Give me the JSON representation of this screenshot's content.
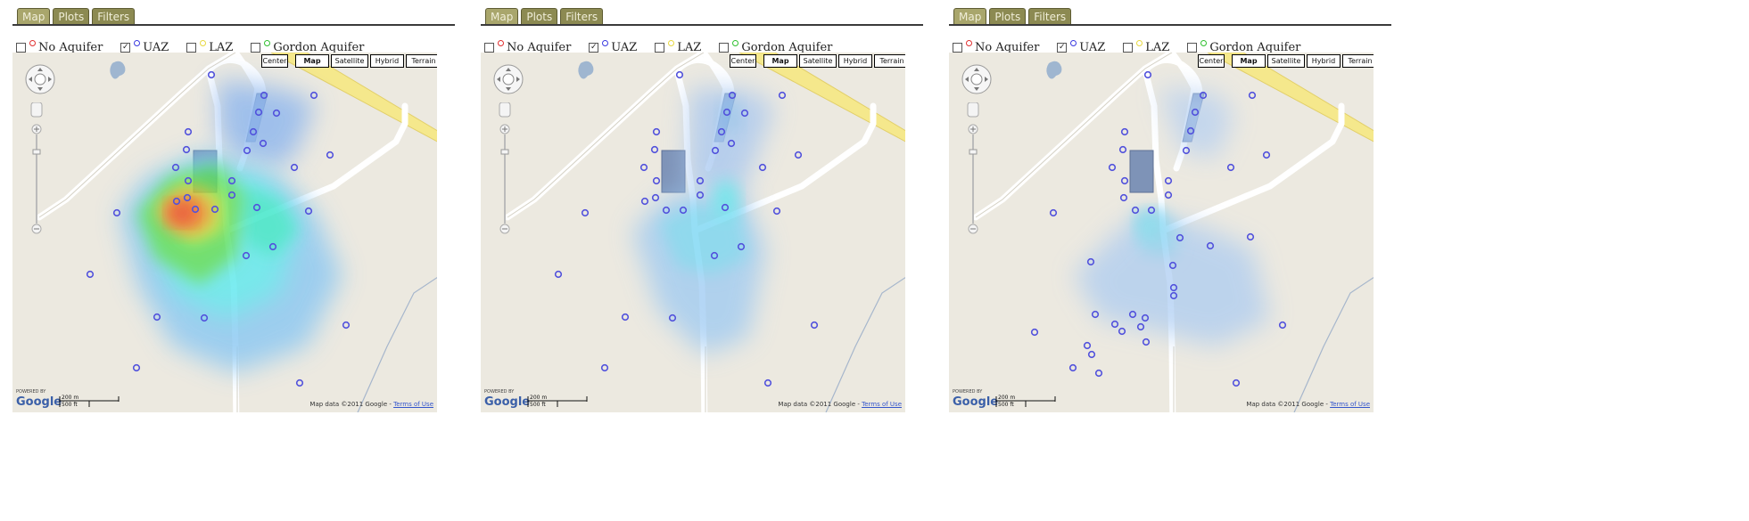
{
  "tabs": [
    "Map",
    "Plots",
    "Filters"
  ],
  "aquifers": [
    {
      "label": "No Aquifer",
      "checked": false,
      "color": "#e03030"
    },
    {
      "label": "UAZ",
      "checked": true,
      "color": "#3a3ae0"
    },
    {
      "label": "LAZ",
      "checked": false,
      "color": "#e8d840"
    },
    {
      "label": "Gordon Aquifer",
      "checked": false,
      "color": "#30c030"
    }
  ],
  "map_controls": {
    "center": "Center",
    "types": [
      "Map",
      "Satellite",
      "Hybrid",
      "Terrain"
    ],
    "selected": "Map"
  },
  "scale": {
    "metric": "200 m",
    "imperial": "500 ft"
  },
  "google": {
    "powered": "POWERED BY",
    "logo": "Google"
  },
  "attribution": {
    "text": "Map data ©2011 Google - ",
    "link": "Terms of Use"
  },
  "colors": {
    "tab": "#8c8a52",
    "site_marker": "#5252dc",
    "road_yellow": "#f5e88c"
  },
  "panels": [
    {
      "name": "map-panel-1",
      "heatmap_intensity": "high"
    },
    {
      "name": "map-panel-2",
      "heatmap_intensity": "medium"
    },
    {
      "name": "map-panel-3",
      "heatmap_intensity": "low"
    }
  ]
}
